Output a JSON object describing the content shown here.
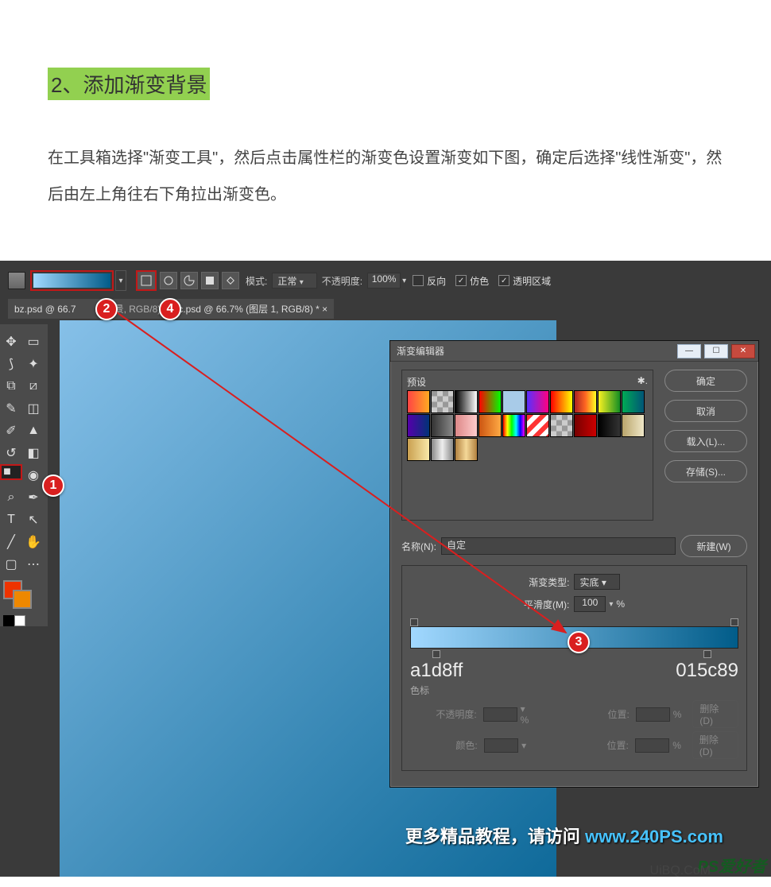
{
  "article": {
    "heading": "2、添加渐变背景",
    "body": "在工具箱选择\"渐变工具\"，然后点击属性栏的渐变色设置渐变如下图，确定后选择\"线性渐变\"，然后由左上角往右下角拉出渐变色。"
  },
  "options_bar": {
    "mode_label": "模式:",
    "mode_value": "正常",
    "opacity_label": "不透明度:",
    "opacity_value": "100%",
    "reverse_label": "反向",
    "dither_label": "仿色",
    "transparency_label": "透明区域",
    "reverse_checked": false,
    "dither_checked": true,
    "transparency_checked": true
  },
  "tabs": {
    "tab1": "bz.psd @ 66.7",
    "tab1_suffix": "景, RGB/8)",
    "tab2": "jc.psd @ 66.7% (图层 1, RGB/8) *  ×"
  },
  "dialog": {
    "title": "渐变编辑器",
    "presets_label": "预设",
    "ok": "确定",
    "cancel": "取消",
    "load": "载入(L)...",
    "save": "存储(S)...",
    "name_label": "名称(N):",
    "name_value": "自定",
    "new_btn": "新建(W)",
    "type_label": "渐变类型:",
    "type_value": "实底",
    "smooth_label": "平滑度(M):",
    "smooth_value": "100",
    "pct": "%",
    "stop_left_hex": "a1d8ff",
    "stop_right_hex": "015c89",
    "stops_label": "色标",
    "op_label": "不透明度:",
    "pos_label": "位置:",
    "del_btn1": "删除(D)",
    "color_label": "颜色:",
    "del_btn2": "删除(D)"
  },
  "markers": {
    "m1": "1",
    "m2": "2",
    "m3": "3",
    "m4": "4"
  },
  "footer": {
    "text": "更多精品教程，请访问 ",
    "url": "www.240PS.com",
    "brand": "PS爱好者",
    "brand2": "UiBQ.CoM"
  },
  "presets": [
    "linear-gradient(90deg,#f44,#fa2)",
    "repeating-conic-gradient(#999 0 25%,#ccc 0 50%) 0/14px 14px",
    "linear-gradient(90deg,#000,#fff)",
    "linear-gradient(90deg,#f00,#0f0)",
    "#a8cbe8",
    "linear-gradient(90deg,#592fff,#ff0080)",
    "linear-gradient(90deg,#f00,#ff0)",
    "linear-gradient(90deg,#a22,#f62,#ff2)",
    "linear-gradient(90deg,#f8f121,#138e23)",
    "linear-gradient(90deg,#0a5,#057)",
    "linear-gradient(90deg,#50a,#037)",
    "linear-gradient(90deg,#333,#888)",
    "linear-gradient(90deg,#d88,#fcc)",
    "linear-gradient(90deg,#c51,#fa4)",
    "linear-gradient(90deg,#f00,#ff0,#0f0,#0ff,#00f,#f0f)",
    "repeating-linear-gradient(135deg,#f33 0 6px,#fff 6px 12px)",
    "repeating-conic-gradient(#999 0 25%,#ccc 0 50%) 0/14px 14px",
    "linear-gradient(90deg,#700,#c00)",
    "linear-gradient(90deg,#000,#333)",
    "linear-gradient(90deg,#b9a56b,#efe7c8)",
    "linear-gradient(90deg,#caa050,#f8e8a8)",
    "linear-gradient(90deg,#888,#eee,#888)",
    "linear-gradient(90deg,#b28140,#f4d898,#b28140)"
  ]
}
